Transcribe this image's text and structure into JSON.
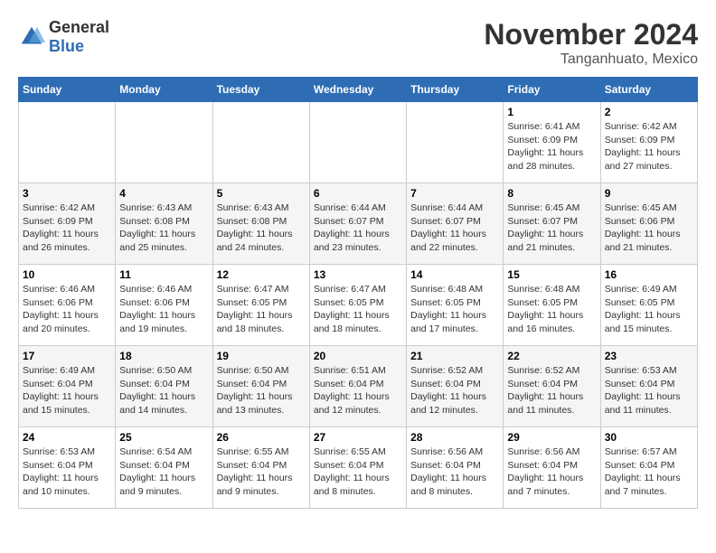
{
  "header": {
    "logo_general": "General",
    "logo_blue": "Blue",
    "month_title": "November 2024",
    "location": "Tanganhuato, Mexico"
  },
  "weekdays": [
    "Sunday",
    "Monday",
    "Tuesday",
    "Wednesday",
    "Thursday",
    "Friday",
    "Saturday"
  ],
  "weeks": [
    [
      {
        "day": "",
        "sunrise": "",
        "sunset": "",
        "daylight": ""
      },
      {
        "day": "",
        "sunrise": "",
        "sunset": "",
        "daylight": ""
      },
      {
        "day": "",
        "sunrise": "",
        "sunset": "",
        "daylight": ""
      },
      {
        "day": "",
        "sunrise": "",
        "sunset": "",
        "daylight": ""
      },
      {
        "day": "",
        "sunrise": "",
        "sunset": "",
        "daylight": ""
      },
      {
        "day": "1",
        "sunrise": "Sunrise: 6:41 AM",
        "sunset": "Sunset: 6:09 PM",
        "daylight": "Daylight: 11 hours and 28 minutes."
      },
      {
        "day": "2",
        "sunrise": "Sunrise: 6:42 AM",
        "sunset": "Sunset: 6:09 PM",
        "daylight": "Daylight: 11 hours and 27 minutes."
      }
    ],
    [
      {
        "day": "3",
        "sunrise": "Sunrise: 6:42 AM",
        "sunset": "Sunset: 6:09 PM",
        "daylight": "Daylight: 11 hours and 26 minutes."
      },
      {
        "day": "4",
        "sunrise": "Sunrise: 6:43 AM",
        "sunset": "Sunset: 6:08 PM",
        "daylight": "Daylight: 11 hours and 25 minutes."
      },
      {
        "day": "5",
        "sunrise": "Sunrise: 6:43 AM",
        "sunset": "Sunset: 6:08 PM",
        "daylight": "Daylight: 11 hours and 24 minutes."
      },
      {
        "day": "6",
        "sunrise": "Sunrise: 6:44 AM",
        "sunset": "Sunset: 6:07 PM",
        "daylight": "Daylight: 11 hours and 23 minutes."
      },
      {
        "day": "7",
        "sunrise": "Sunrise: 6:44 AM",
        "sunset": "Sunset: 6:07 PM",
        "daylight": "Daylight: 11 hours and 22 minutes."
      },
      {
        "day": "8",
        "sunrise": "Sunrise: 6:45 AM",
        "sunset": "Sunset: 6:07 PM",
        "daylight": "Daylight: 11 hours and 21 minutes."
      },
      {
        "day": "9",
        "sunrise": "Sunrise: 6:45 AM",
        "sunset": "Sunset: 6:06 PM",
        "daylight": "Daylight: 11 hours and 21 minutes."
      }
    ],
    [
      {
        "day": "10",
        "sunrise": "Sunrise: 6:46 AM",
        "sunset": "Sunset: 6:06 PM",
        "daylight": "Daylight: 11 hours and 20 minutes."
      },
      {
        "day": "11",
        "sunrise": "Sunrise: 6:46 AM",
        "sunset": "Sunset: 6:06 PM",
        "daylight": "Daylight: 11 hours and 19 minutes."
      },
      {
        "day": "12",
        "sunrise": "Sunrise: 6:47 AM",
        "sunset": "Sunset: 6:05 PM",
        "daylight": "Daylight: 11 hours and 18 minutes."
      },
      {
        "day": "13",
        "sunrise": "Sunrise: 6:47 AM",
        "sunset": "Sunset: 6:05 PM",
        "daylight": "Daylight: 11 hours and 18 minutes."
      },
      {
        "day": "14",
        "sunrise": "Sunrise: 6:48 AM",
        "sunset": "Sunset: 6:05 PM",
        "daylight": "Daylight: 11 hours and 17 minutes."
      },
      {
        "day": "15",
        "sunrise": "Sunrise: 6:48 AM",
        "sunset": "Sunset: 6:05 PM",
        "daylight": "Daylight: 11 hours and 16 minutes."
      },
      {
        "day": "16",
        "sunrise": "Sunrise: 6:49 AM",
        "sunset": "Sunset: 6:05 PM",
        "daylight": "Daylight: 11 hours and 15 minutes."
      }
    ],
    [
      {
        "day": "17",
        "sunrise": "Sunrise: 6:49 AM",
        "sunset": "Sunset: 6:04 PM",
        "daylight": "Daylight: 11 hours and 15 minutes."
      },
      {
        "day": "18",
        "sunrise": "Sunrise: 6:50 AM",
        "sunset": "Sunset: 6:04 PM",
        "daylight": "Daylight: 11 hours and 14 minutes."
      },
      {
        "day": "19",
        "sunrise": "Sunrise: 6:50 AM",
        "sunset": "Sunset: 6:04 PM",
        "daylight": "Daylight: 11 hours and 13 minutes."
      },
      {
        "day": "20",
        "sunrise": "Sunrise: 6:51 AM",
        "sunset": "Sunset: 6:04 PM",
        "daylight": "Daylight: 11 hours and 12 minutes."
      },
      {
        "day": "21",
        "sunrise": "Sunrise: 6:52 AM",
        "sunset": "Sunset: 6:04 PM",
        "daylight": "Daylight: 11 hours and 12 minutes."
      },
      {
        "day": "22",
        "sunrise": "Sunrise: 6:52 AM",
        "sunset": "Sunset: 6:04 PM",
        "daylight": "Daylight: 11 hours and 11 minutes."
      },
      {
        "day": "23",
        "sunrise": "Sunrise: 6:53 AM",
        "sunset": "Sunset: 6:04 PM",
        "daylight": "Daylight: 11 hours and 11 minutes."
      }
    ],
    [
      {
        "day": "24",
        "sunrise": "Sunrise: 6:53 AM",
        "sunset": "Sunset: 6:04 PM",
        "daylight": "Daylight: 11 hours and 10 minutes."
      },
      {
        "day": "25",
        "sunrise": "Sunrise: 6:54 AM",
        "sunset": "Sunset: 6:04 PM",
        "daylight": "Daylight: 11 hours and 9 minutes."
      },
      {
        "day": "26",
        "sunrise": "Sunrise: 6:55 AM",
        "sunset": "Sunset: 6:04 PM",
        "daylight": "Daylight: 11 hours and 9 minutes."
      },
      {
        "day": "27",
        "sunrise": "Sunrise: 6:55 AM",
        "sunset": "Sunset: 6:04 PM",
        "daylight": "Daylight: 11 hours and 8 minutes."
      },
      {
        "day": "28",
        "sunrise": "Sunrise: 6:56 AM",
        "sunset": "Sunset: 6:04 PM",
        "daylight": "Daylight: 11 hours and 8 minutes."
      },
      {
        "day": "29",
        "sunrise": "Sunrise: 6:56 AM",
        "sunset": "Sunset: 6:04 PM",
        "daylight": "Daylight: 11 hours and 7 minutes."
      },
      {
        "day": "30",
        "sunrise": "Sunrise: 6:57 AM",
        "sunset": "Sunset: 6:04 PM",
        "daylight": "Daylight: 11 hours and 7 minutes."
      }
    ]
  ]
}
